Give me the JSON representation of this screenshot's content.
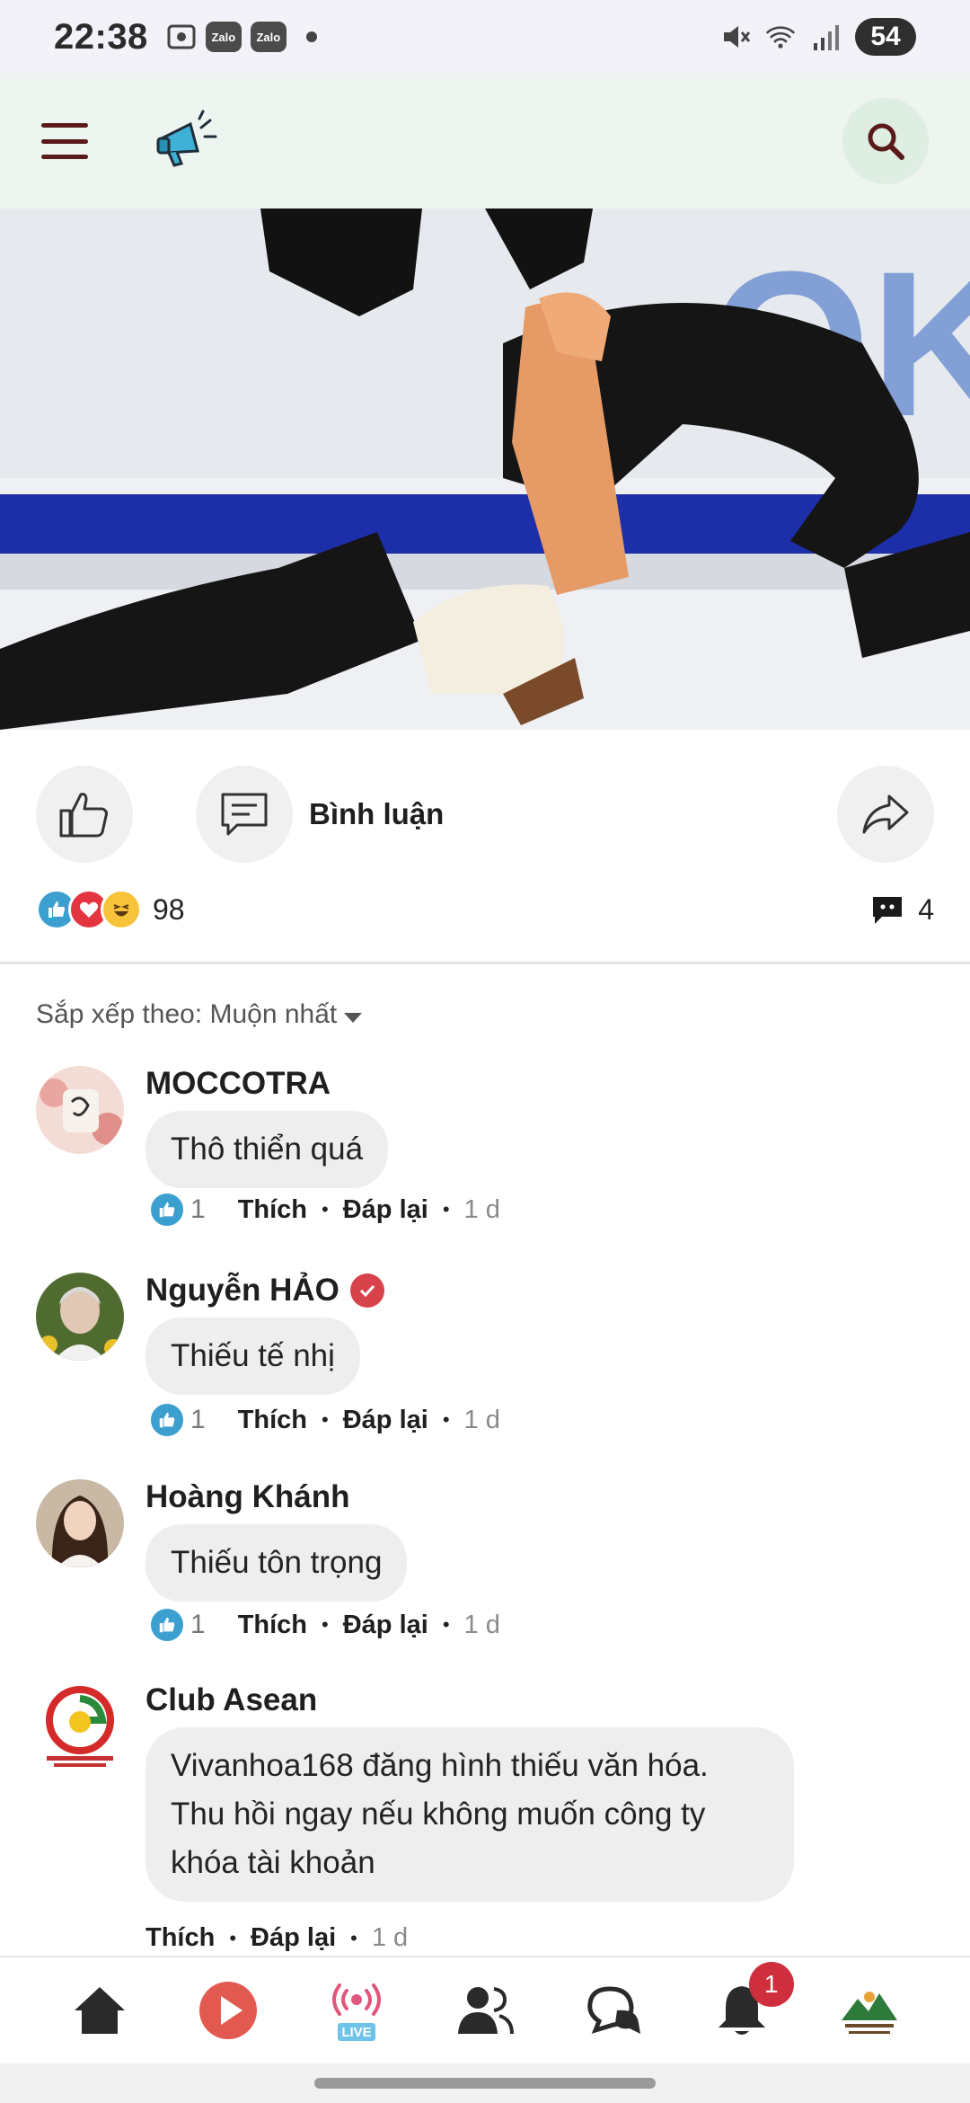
{
  "status_bar": {
    "time": "22:38",
    "zalo_label": "Zalo",
    "battery": "54",
    "icons": [
      "screenshot-icon",
      "zalo-icon",
      "zalo-icon",
      "notification-dot",
      "mute-icon",
      "wifi-icon",
      "signal-icon",
      "battery-icon"
    ]
  },
  "header": {
    "icons": [
      "menu-icon",
      "megaphone-icon",
      "search-icon"
    ]
  },
  "post": {
    "image_text": "OK",
    "comment_label": "Bình luận",
    "reaction_count": "98",
    "comment_count": "4"
  },
  "sort": {
    "label": "Sắp xếp theo: Muộn nhất"
  },
  "comments": [
    {
      "name": "MOCCOTRA",
      "text": "Thô thiển quá",
      "likes": "1",
      "like_label": "Thích",
      "reply_label": "Đáp lại",
      "time": "1 d",
      "verified": false
    },
    {
      "name": "Nguyễn HẢO",
      "text": "Thiếu tế nhị",
      "likes": "1",
      "like_label": "Thích",
      "reply_label": "Đáp lại",
      "time": "1 d",
      "verified": true
    },
    {
      "name": "Hoàng Khánh",
      "text": "Thiếu tôn trọng",
      "likes": "1",
      "like_label": "Thích",
      "reply_label": "Đáp lại",
      "time": "1 d",
      "verified": false
    },
    {
      "name": "Club Asean",
      "text_lines": [
        "Vivanhoa168 đăng hình thiếu văn hóa.",
        "Thu hồi ngay nếu không muốn công ty",
        "khóa tài khoản"
      ],
      "like_label": "Thích",
      "reply_label": "Đáp lại",
      "time": "1 d",
      "verified": false
    }
  ],
  "bottom_nav": {
    "items": [
      "home-icon",
      "play-icon",
      "live-icon",
      "friends-icon",
      "chat-icon",
      "bell-icon",
      "profile-avatar"
    ],
    "live_label": "LIVE",
    "notification_count": "1"
  },
  "colors": {
    "header_bg": "#eef4ef",
    "accent_red": "#cf2f3c",
    "like_blue": "#3b9fcf",
    "live_pink": "#e0577d"
  }
}
